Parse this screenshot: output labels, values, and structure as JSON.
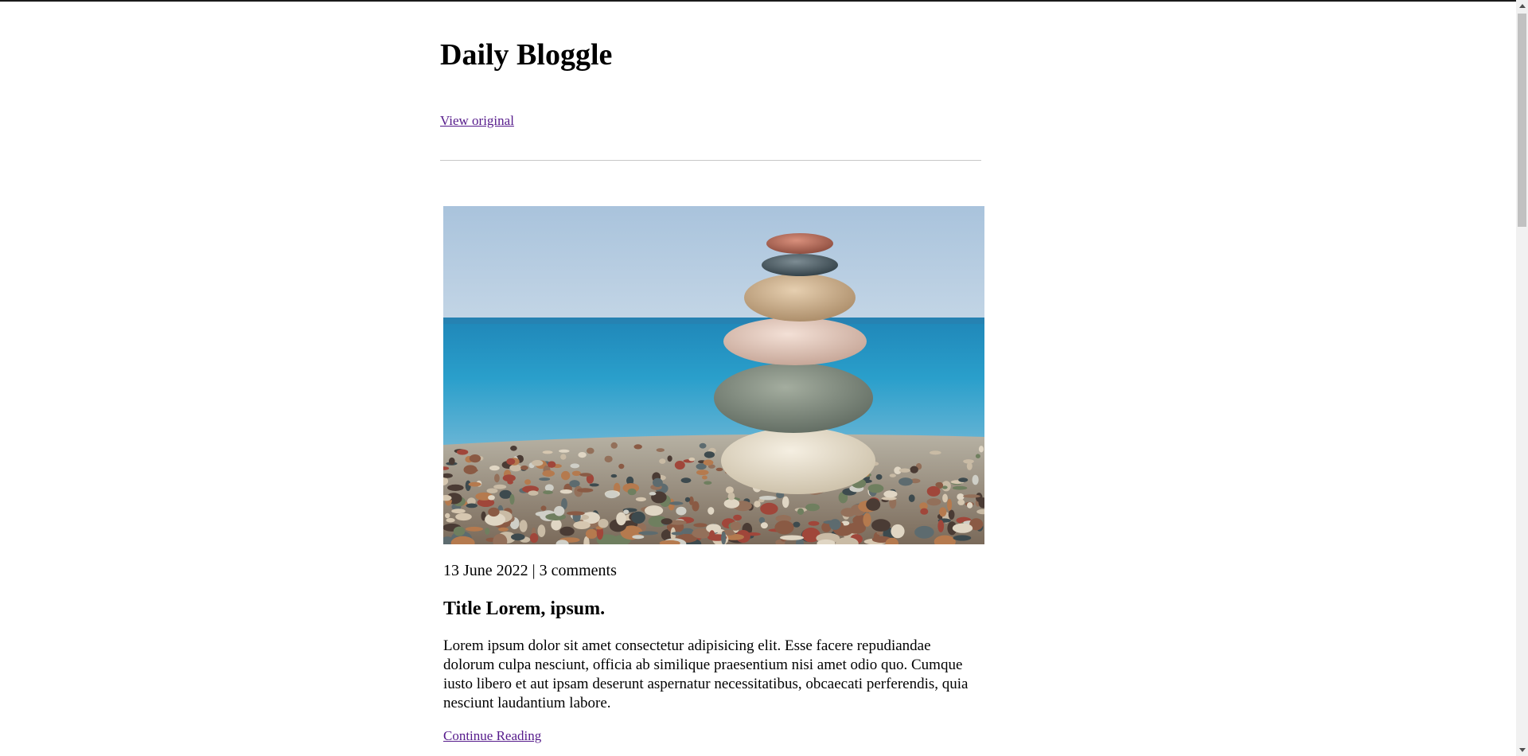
{
  "site": {
    "title": "Daily Bloggle",
    "view_original_label": "View original"
  },
  "post": {
    "meta": "13 June 2022 | 3 comments",
    "title": "Title Lorem, ipsum.",
    "body": "Lorem ipsum dolor sit amet consectetur adipisicing elit. Esse facere repudiandae dolorum culpa nesciunt, officia ab similique praesentium nisi amet odio quo. Cumque iusto libero et aut ipsam deserunt aspernatur necessitatibus, obcaecati perferendis, quia nesciunt laudantium labore.",
    "continue_label": "Continue Reading",
    "image_subject": "stacked stones on pebble beach by the sea"
  },
  "icons": {
    "scroll_up": "triangle-up-icon",
    "scroll_down": "triangle-down-icon"
  },
  "colors": {
    "link_visited": "#551a8b",
    "divider": "#c8c8c8",
    "scrollbar_track": "#f1f1f1",
    "scrollbar_thumb": "#c1c1c1"
  }
}
